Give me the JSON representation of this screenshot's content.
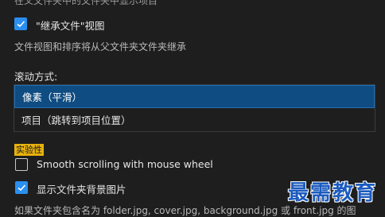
{
  "top_cut_text": "在父文件夹中的文件夹中显示项目",
  "inherit_view": {
    "checked": true,
    "label": "\"继承文件\"视图",
    "description": "文件视图和排序将从父文件夹文件夹继承"
  },
  "scroll_mode": {
    "label": "滚动方式:",
    "options": [
      {
        "label": "像素（平滑）",
        "selected": true
      },
      {
        "label": "项目（跳转到项目位置）",
        "selected": false
      }
    ]
  },
  "experimental_badge": "实验性",
  "smooth_scrolling": {
    "checked": false,
    "label": "Smooth scrolling with mouse wheel"
  },
  "show_background": {
    "checked": true,
    "label": "显示文件夹背景图片",
    "description": "如果文件夹包含名为 folder.jpg, cover.jpg, background.jpg 或 front.jpg 的图"
  },
  "watermark": "最需教育",
  "colors": {
    "background": "#1e1e1e",
    "accent": "#2a8ff0",
    "selected_row": "#0e4c82",
    "badge": "#e7b20e"
  }
}
